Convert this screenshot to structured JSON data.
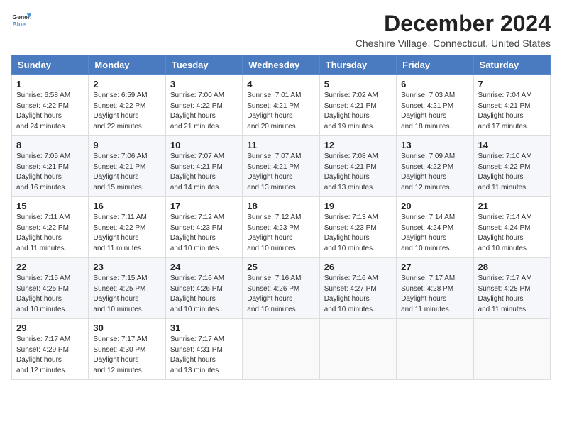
{
  "header": {
    "logo_line1": "General",
    "logo_line2": "Blue",
    "month": "December 2024",
    "location": "Cheshire Village, Connecticut, United States"
  },
  "days_of_week": [
    "Sunday",
    "Monday",
    "Tuesday",
    "Wednesday",
    "Thursday",
    "Friday",
    "Saturday"
  ],
  "weeks": [
    [
      {
        "day": "1",
        "sunrise": "6:58 AM",
        "sunset": "4:22 PM",
        "daylight": "9 hours and 24 minutes."
      },
      {
        "day": "2",
        "sunrise": "6:59 AM",
        "sunset": "4:22 PM",
        "daylight": "9 hours and 22 minutes."
      },
      {
        "day": "3",
        "sunrise": "7:00 AM",
        "sunset": "4:22 PM",
        "daylight": "9 hours and 21 minutes."
      },
      {
        "day": "4",
        "sunrise": "7:01 AM",
        "sunset": "4:21 PM",
        "daylight": "9 hours and 20 minutes."
      },
      {
        "day": "5",
        "sunrise": "7:02 AM",
        "sunset": "4:21 PM",
        "daylight": "9 hours and 19 minutes."
      },
      {
        "day": "6",
        "sunrise": "7:03 AM",
        "sunset": "4:21 PM",
        "daylight": "9 hours and 18 minutes."
      },
      {
        "day": "7",
        "sunrise": "7:04 AM",
        "sunset": "4:21 PM",
        "daylight": "9 hours and 17 minutes."
      }
    ],
    [
      {
        "day": "8",
        "sunrise": "7:05 AM",
        "sunset": "4:21 PM",
        "daylight": "9 hours and 16 minutes."
      },
      {
        "day": "9",
        "sunrise": "7:06 AM",
        "sunset": "4:21 PM",
        "daylight": "9 hours and 15 minutes."
      },
      {
        "day": "10",
        "sunrise": "7:07 AM",
        "sunset": "4:21 PM",
        "daylight": "9 hours and 14 minutes."
      },
      {
        "day": "11",
        "sunrise": "7:07 AM",
        "sunset": "4:21 PM",
        "daylight": "9 hours and 13 minutes."
      },
      {
        "day": "12",
        "sunrise": "7:08 AM",
        "sunset": "4:21 PM",
        "daylight": "9 hours and 13 minutes."
      },
      {
        "day": "13",
        "sunrise": "7:09 AM",
        "sunset": "4:22 PM",
        "daylight": "9 hours and 12 minutes."
      },
      {
        "day": "14",
        "sunrise": "7:10 AM",
        "sunset": "4:22 PM",
        "daylight": "9 hours and 11 minutes."
      }
    ],
    [
      {
        "day": "15",
        "sunrise": "7:11 AM",
        "sunset": "4:22 PM",
        "daylight": "9 hours and 11 minutes."
      },
      {
        "day": "16",
        "sunrise": "7:11 AM",
        "sunset": "4:22 PM",
        "daylight": "9 hours and 11 minutes."
      },
      {
        "day": "17",
        "sunrise": "7:12 AM",
        "sunset": "4:23 PM",
        "daylight": "9 hours and 10 minutes."
      },
      {
        "day": "18",
        "sunrise": "7:12 AM",
        "sunset": "4:23 PM",
        "daylight": "9 hours and 10 minutes."
      },
      {
        "day": "19",
        "sunrise": "7:13 AM",
        "sunset": "4:23 PM",
        "daylight": "9 hours and 10 minutes."
      },
      {
        "day": "20",
        "sunrise": "7:14 AM",
        "sunset": "4:24 PM",
        "daylight": "9 hours and 10 minutes."
      },
      {
        "day": "21",
        "sunrise": "7:14 AM",
        "sunset": "4:24 PM",
        "daylight": "9 hours and 10 minutes."
      }
    ],
    [
      {
        "day": "22",
        "sunrise": "7:15 AM",
        "sunset": "4:25 PM",
        "daylight": "9 hours and 10 minutes."
      },
      {
        "day": "23",
        "sunrise": "7:15 AM",
        "sunset": "4:25 PM",
        "daylight": "9 hours and 10 minutes."
      },
      {
        "day": "24",
        "sunrise": "7:16 AM",
        "sunset": "4:26 PM",
        "daylight": "9 hours and 10 minutes."
      },
      {
        "day": "25",
        "sunrise": "7:16 AM",
        "sunset": "4:26 PM",
        "daylight": "9 hours and 10 minutes."
      },
      {
        "day": "26",
        "sunrise": "7:16 AM",
        "sunset": "4:27 PM",
        "daylight": "9 hours and 10 minutes."
      },
      {
        "day": "27",
        "sunrise": "7:17 AM",
        "sunset": "4:28 PM",
        "daylight": "9 hours and 11 minutes."
      },
      {
        "day": "28",
        "sunrise": "7:17 AM",
        "sunset": "4:28 PM",
        "daylight": "9 hours and 11 minutes."
      }
    ],
    [
      {
        "day": "29",
        "sunrise": "7:17 AM",
        "sunset": "4:29 PM",
        "daylight": "9 hours and 12 minutes."
      },
      {
        "day": "30",
        "sunrise": "7:17 AM",
        "sunset": "4:30 PM",
        "daylight": "9 hours and 12 minutes."
      },
      {
        "day": "31",
        "sunrise": "7:17 AM",
        "sunset": "4:31 PM",
        "daylight": "9 hours and 13 minutes."
      },
      null,
      null,
      null,
      null
    ]
  ]
}
